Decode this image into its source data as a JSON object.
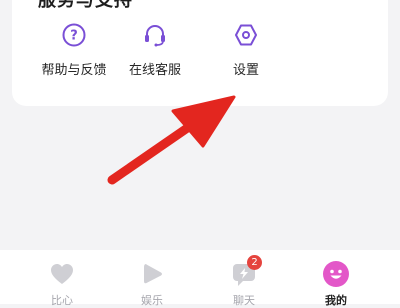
{
  "section": {
    "title": "服务与支持",
    "items": [
      {
        "label": "帮助与反馈",
        "icon": "help-icon"
      },
      {
        "label": "在线客服",
        "icon": "headset-icon"
      },
      {
        "label": "设置",
        "icon": "settings-icon"
      }
    ]
  },
  "tabbar": {
    "items": [
      {
        "label": "比心",
        "icon": "heart-icon"
      },
      {
        "label": "娱乐",
        "icon": "play-icon"
      },
      {
        "label": "聊天",
        "icon": "chat-icon",
        "badge": "2"
      },
      {
        "label": "我的",
        "icon": "smiley-icon",
        "active": true
      }
    ]
  },
  "colors": {
    "accent": "#7a4fd6",
    "active_tab": "#e357c8",
    "badge": "#e5443e",
    "arrow": "#e3261f",
    "inactive_icon": "#cfcfd4"
  }
}
